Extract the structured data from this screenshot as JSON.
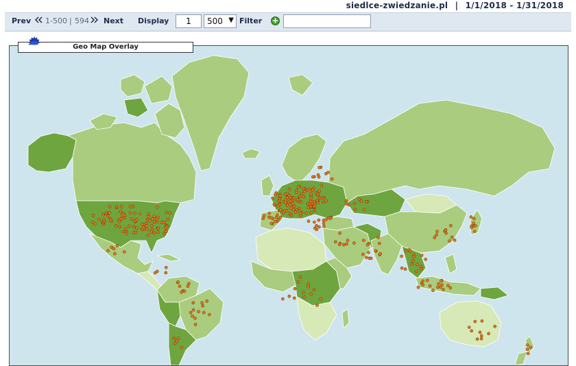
{
  "header": {
    "site": "siedlce-zwiedzanie.pl",
    "separator": "|",
    "date_range": "1/1/2018 - 1/31/2018"
  },
  "toolbar": {
    "prev_label": "Prev",
    "prev_icon": "double-chevron-left-icon",
    "range_label": "1-500",
    "divider": "|",
    "total": "594",
    "next_icon": "double-chevron-right-icon",
    "next_label": "Next",
    "display_label": "Display",
    "page_value": "1",
    "per_page_value": "500",
    "filter_label": "Filter",
    "filter_icon": "add-filter-icon",
    "filter_value": ""
  },
  "panel": {
    "title": "Geo Map Overlay",
    "icon": "settings-gear-icon"
  },
  "colors": {
    "ocean": "#cfe5ee",
    "land": "#a9cc7e",
    "land_dark": "#6ea53f",
    "land_light": "#d8e9b8",
    "marker": "#e07b1b"
  }
}
